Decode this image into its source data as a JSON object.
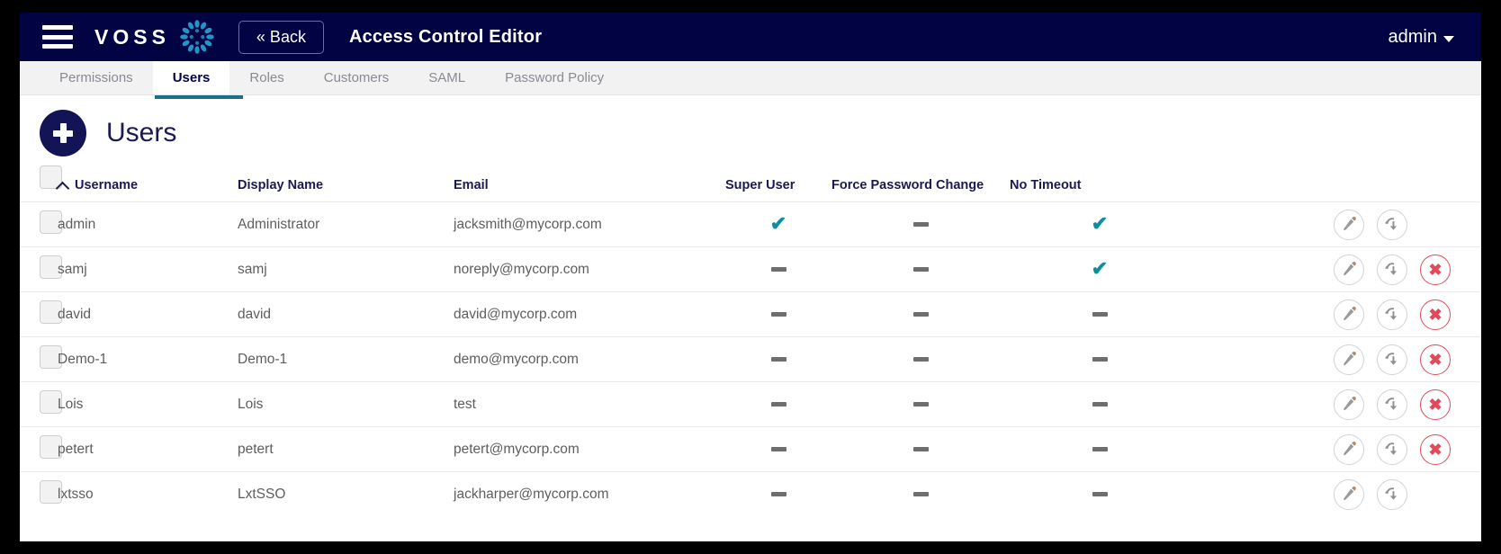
{
  "navbar": {
    "menu_icon": "hamburger-icon",
    "brand_text": "VOSS",
    "brand_mark_icon": "voss-burst-logo-icon",
    "back_label": "« Back",
    "app_title": "Access Control Editor",
    "user_label": "admin",
    "user_caret_icon": "caret-down-icon",
    "background_color": "#010342"
  },
  "tabs": [
    {
      "label": "Permissions",
      "active": false
    },
    {
      "label": "Users",
      "active": true
    },
    {
      "label": "Roles",
      "active": false
    },
    {
      "label": "Customers",
      "active": false
    },
    {
      "label": "SAML",
      "active": false
    },
    {
      "label": "Password Policy",
      "active": false
    }
  ],
  "page": {
    "title": "Users",
    "add_button_icon": "plus-icon",
    "accent_color": "#1c6e8c"
  },
  "table": {
    "columns": [
      {
        "key": "select",
        "label": ""
      },
      {
        "key": "username",
        "label": "Username",
        "sorted": "asc",
        "sort_icon": "chevron-up-icon"
      },
      {
        "key": "display_name",
        "label": "Display Name"
      },
      {
        "key": "email",
        "label": "Email"
      },
      {
        "key": "super_user",
        "label": "Super User"
      },
      {
        "key": "force_password_change",
        "label": "Force Password Change"
      },
      {
        "key": "no_timeout",
        "label": "No Timeout"
      },
      {
        "key": "actions",
        "label": ""
      }
    ],
    "check_glyph": "✔",
    "dash_glyph": "—",
    "check_color": "#0d8f9e",
    "dash_color": "#6e6e6e",
    "actions": {
      "edit_icon": "pencil-icon",
      "clone_icon": "clone-download-icon",
      "delete_icon": "close-x-icon",
      "delete_color": "#e04a5a"
    },
    "rows": [
      {
        "username": "admin",
        "display_name": "Administrator",
        "email": "jacksmith@mycorp.com",
        "super_user": true,
        "force_password_change": false,
        "no_timeout": true,
        "deletable": false
      },
      {
        "username": "samj",
        "display_name": "samj",
        "email": "noreply@mycorp.com",
        "super_user": false,
        "force_password_change": false,
        "no_timeout": true,
        "deletable": true
      },
      {
        "username": "david",
        "display_name": "david",
        "email": "david@mycorp.com",
        "super_user": false,
        "force_password_change": false,
        "no_timeout": false,
        "deletable": true
      },
      {
        "username": "Demo-1",
        "display_name": "Demo-1",
        "email": "demo@mycorp.com",
        "super_user": false,
        "force_password_change": false,
        "no_timeout": false,
        "deletable": true
      },
      {
        "username": "Lois",
        "display_name": "Lois",
        "email": "test",
        "super_user": false,
        "force_password_change": false,
        "no_timeout": false,
        "deletable": true
      },
      {
        "username": "petert",
        "display_name": "petert",
        "email": "petert@mycorp.com",
        "super_user": false,
        "force_password_change": false,
        "no_timeout": false,
        "deletable": true
      },
      {
        "username": "lxtsso",
        "display_name": "LxtSSO",
        "email": "jackharper@mycorp.com",
        "super_user": false,
        "force_password_change": false,
        "no_timeout": false,
        "deletable": false
      }
    ]
  }
}
